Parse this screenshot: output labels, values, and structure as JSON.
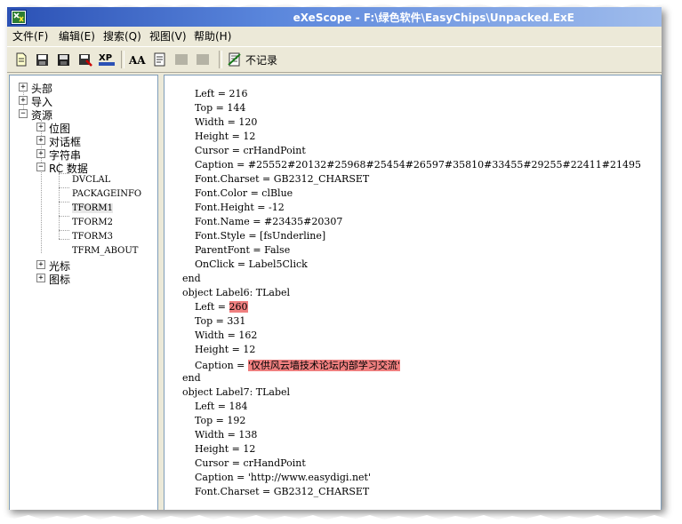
{
  "window": {
    "title": "eXeScope - F:\\绿色软件\\EasyChips\\Unpacked.ExE",
    "app_icon": "exescope-app-icon"
  },
  "menu": [
    {
      "label": "文件(F)"
    },
    {
      "label": "编辑(E)"
    },
    {
      "label": "搜索(Q)"
    },
    {
      "label": "视图(V)"
    },
    {
      "label": "帮助(H)"
    }
  ],
  "toolbar": {
    "icons": [
      "new-document-icon",
      "open-icon",
      "save-icon",
      "export-icon",
      "xp-style-icon",
      "font-icon",
      "hex-icon",
      "disabled-icon",
      "disabled-icon"
    ],
    "xp_label": "XP",
    "font_label": "AA",
    "norecord_icon": "no-record-icon",
    "norecord_label": "不记录"
  },
  "tree": {
    "items": [
      {
        "label": "头部"
      },
      {
        "label": "导入"
      },
      {
        "label": "资源"
      },
      {
        "label": "位图"
      },
      {
        "label": "对话框"
      },
      {
        "label": "字符串"
      },
      {
        "label": "RC 数据"
      },
      {
        "label": "DVCLAL"
      },
      {
        "label": "PACKAGEINFO"
      },
      {
        "label": "TFORM1"
      },
      {
        "label": "TFORM2"
      },
      {
        "label": "TFORM3"
      },
      {
        "label": "TFRM_ABOUT"
      },
      {
        "label": "光标"
      },
      {
        "label": "图标"
      }
    ]
  },
  "code": {
    "lines": [
      {
        "prefix": "    Left = 216",
        "highlight": "",
        "suffix": ""
      },
      {
        "prefix": "    Top = 144",
        "highlight": "",
        "suffix": ""
      },
      {
        "prefix": "    Width = 120",
        "highlight": "",
        "suffix": ""
      },
      {
        "prefix": "    Height = 12",
        "highlight": "",
        "suffix": ""
      },
      {
        "prefix": "    Cursor = crHandPoint",
        "highlight": "",
        "suffix": ""
      },
      {
        "prefix": "    Caption = #25552#20132#25968#25454#26597#35810#33455#29255#22411#21495",
        "highlight": "",
        "suffix": ""
      },
      {
        "prefix": "    Font.Charset = GB2312_CHARSET",
        "highlight": "",
        "suffix": ""
      },
      {
        "prefix": "    Font.Color = clBlue",
        "highlight": "",
        "suffix": ""
      },
      {
        "prefix": "    Font.Height = -12",
        "highlight": "",
        "suffix": ""
      },
      {
        "prefix": "    Font.Name = #23435#20307",
        "highlight": "",
        "suffix": ""
      },
      {
        "prefix": "    Font.Style = [fsUnderline]",
        "highlight": "",
        "suffix": ""
      },
      {
        "prefix": "    ParentFont = False",
        "highlight": "",
        "suffix": ""
      },
      {
        "prefix": "    OnClick = Label5Click",
        "highlight": "",
        "suffix": ""
      },
      {
        "prefix": "end",
        "highlight": "",
        "suffix": ""
      },
      {
        "prefix": "object Label6: TLabel",
        "highlight": "",
        "suffix": ""
      },
      {
        "prefix": "    Left = ",
        "highlight": "260",
        "suffix": ""
      },
      {
        "prefix": "    Top = 331",
        "highlight": "",
        "suffix": ""
      },
      {
        "prefix": "    Width = 162",
        "highlight": "",
        "suffix": ""
      },
      {
        "prefix": "    Height = 12",
        "highlight": "",
        "suffix": ""
      },
      {
        "prefix": "    Caption = ",
        "highlight": "'仅供风云墙技术论坛内部学习交流'",
        "suffix": ""
      },
      {
        "prefix": "end",
        "highlight": "",
        "suffix": ""
      },
      {
        "prefix": "object Label7: TLabel",
        "highlight": "",
        "suffix": ""
      },
      {
        "prefix": "    Left = 184",
        "highlight": "",
        "suffix": ""
      },
      {
        "prefix": "    Top = 192",
        "highlight": "",
        "suffix": ""
      },
      {
        "prefix": "    Width = 138",
        "highlight": "",
        "suffix": ""
      },
      {
        "prefix": "    Height = 12",
        "highlight": "",
        "suffix": ""
      },
      {
        "prefix": "    Cursor = crHandPoint",
        "highlight": "",
        "suffix": ""
      },
      {
        "prefix": "    Caption = 'http://www.easydigi.net'",
        "highlight": "",
        "suffix": ""
      },
      {
        "prefix": "    Font.Charset = GB2312_CHARSET",
        "highlight": "",
        "suffix": ""
      }
    ]
  },
  "colors": {
    "highlight": "#f08080",
    "titlebar": "#2b51b5",
    "window_bg": "#ece9d8"
  }
}
